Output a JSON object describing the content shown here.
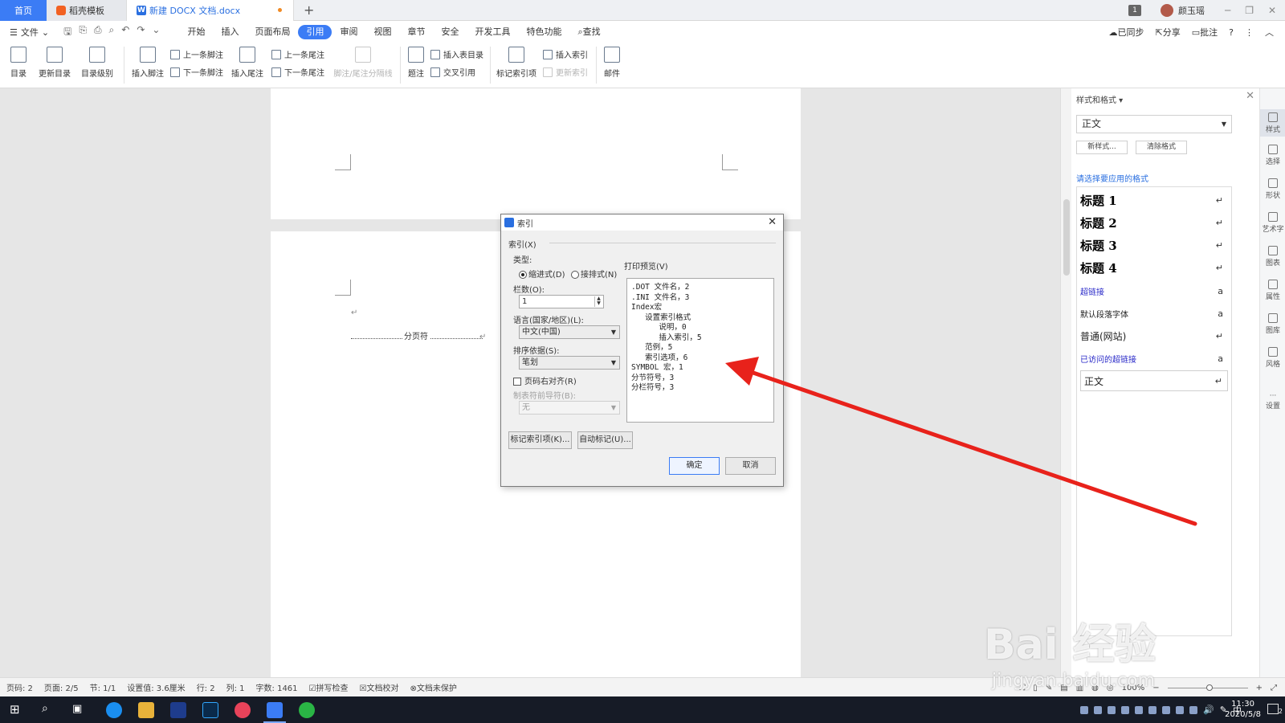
{
  "tabs": {
    "home": "首页",
    "templates": "稻壳模板",
    "document": "新建 DOCX 文档.docx",
    "add": "+"
  },
  "titlebar": {
    "badge": "1",
    "user": "颜玉瑶"
  },
  "menubar": {
    "file": "文件",
    "items": [
      "开始",
      "插入",
      "页面布局",
      "引用",
      "审阅",
      "视图",
      "章节",
      "安全",
      "开发工具",
      "特色功能"
    ],
    "search": "查找",
    "right": {
      "sync": "已同步",
      "share": "分享",
      "comment": "批注"
    }
  },
  "ribbon": {
    "toc": "目录",
    "update_toc": "更新目录",
    "toc_level": "目录级别",
    "insert_footnote": "插入脚注",
    "prev_footnote": "上一条脚注",
    "next_footnote": "下一条脚注",
    "insert_endnote": "插入尾注",
    "prev_endnote": "上一条尾注",
    "next_endnote": "下一条尾注",
    "separator": "脚注/尾注分隔线",
    "caption": "题注",
    "insert_table_toc": "插入表目录",
    "cross_ref": "交叉引用",
    "mark_index": "标记索引项",
    "insert_index": "插入索引",
    "update_index": "更新索引",
    "mail": "邮件"
  },
  "document": {
    "page_break": "分页符"
  },
  "dialog": {
    "title": "索引",
    "section": "索引(X)",
    "type_label": "类型:",
    "type_indented": "缩进式(D)",
    "type_runin": "接排式(N)",
    "columns_label": "栏数(O):",
    "columns_value": "1",
    "language_label": "语言(国家/地区)(L):",
    "language_value": "中文(中国)",
    "sort_label": "排序依据(S):",
    "sort_value": "笔划",
    "right_align": "页码右对齐(R)",
    "tab_leader_label": "制表符前导符(B):",
    "tab_leader_value": "无",
    "preview_label": "打印预览(V)",
    "preview_lines": [
      ".DOT 文件名，2",
      ".INI 文件名，3",
      "Index宏",
      "   设置索引格式",
      "      说明，0",
      "      插入索引，5",
      "   范例，5",
      "   索引选项，6",
      "SYMBOL 宏，1",
      "分节符号，3",
      "分栏符号，3"
    ],
    "mark_entry": "标记索引项(K)...",
    "auto_mark": "自动标记(U)...",
    "ok": "确定",
    "cancel": "取消"
  },
  "style_panel": {
    "title": "样式和格式",
    "current": "正文",
    "new_style": "新样式...",
    "clear_format": "清除格式",
    "hint": "请选择要应用的格式",
    "styles": [
      "标题 1",
      "标题 2",
      "标题 3",
      "标题 4",
      "超链接",
      "默认段落字体",
      "普通(网站)",
      "已访问的超链接",
      "正文"
    ]
  },
  "sidebar": [
    "样式",
    "选择",
    "形状",
    "艺术字",
    "图表",
    "属性",
    "图库",
    "风格",
    "设置"
  ],
  "statusbar": {
    "page_num": "页码: 2",
    "pages": "页面: 2/5",
    "section": "节: 1/1",
    "setting": "设置值: 3.6厘米",
    "row": "行: 2",
    "col": "列: 1",
    "words": "字数: 1461",
    "spell": "拼写检查",
    "proof": "文档校对",
    "protect": "文档未保护",
    "zoom": "100%"
  },
  "taskbar": {
    "time": "11:30",
    "date": "2020/5/8",
    "ime": "中",
    "notif_count": "2"
  },
  "watermark": {
    "brand": "Bai 经验",
    "url": "jingyan.baidu.com"
  },
  "colors": {
    "accent": "#3b7cf5",
    "arrow": "#e8221b",
    "taskbar": "#161b26"
  }
}
